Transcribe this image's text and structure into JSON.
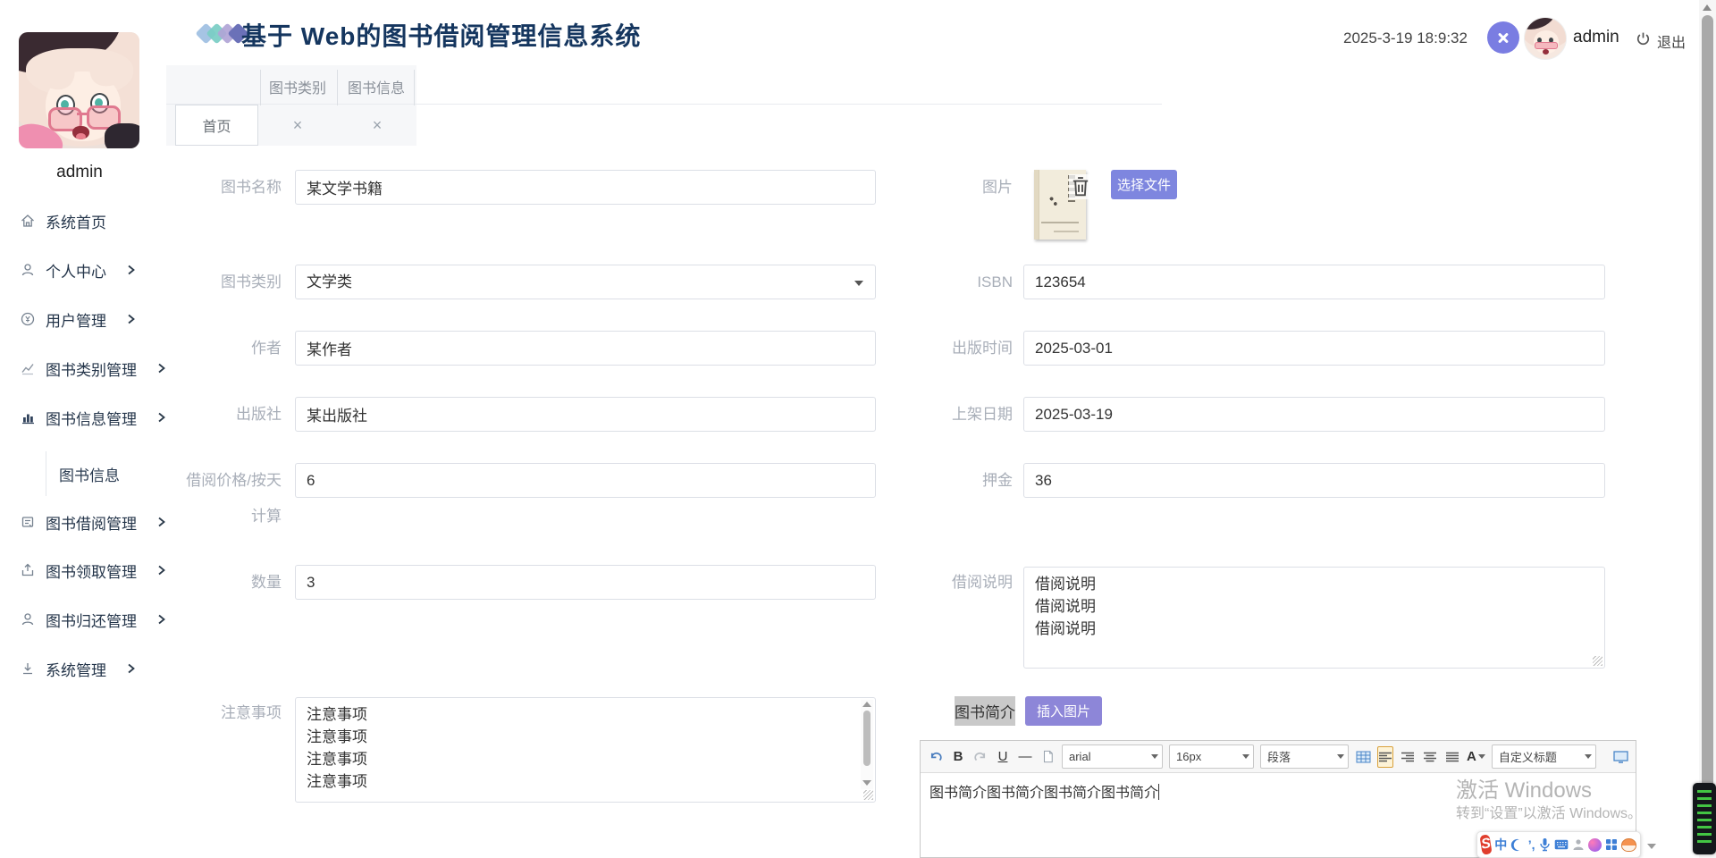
{
  "header": {
    "title": "基于 Web的图书借阅管理信息系统",
    "datetime": "2025-3-19 18:9:32",
    "username": "admin",
    "logout": "退出"
  },
  "sidebar": {
    "username": "admin",
    "items": [
      {
        "label": "系统首页"
      },
      {
        "label": "个人中心"
      },
      {
        "label": "用户管理"
      },
      {
        "label": "图书类别管理"
      },
      {
        "label": "图书信息管理"
      },
      {
        "label": "图书借阅管理"
      },
      {
        "label": "图书领取管理"
      },
      {
        "label": "图书归还管理"
      },
      {
        "label": "系统管理"
      }
    ],
    "submenu": {
      "label": "图书信息"
    }
  },
  "tabs": {
    "home": "首页",
    "category": "图书类别",
    "book_info": "图书信息",
    "close_glyph": "×"
  },
  "form_left": {
    "book_name_label": "图书名称",
    "book_name_value": "某文学书籍",
    "category_label": "图书类别",
    "category_value": "文学类",
    "author_label": "作者",
    "author_value": "某作者",
    "publisher_label": "出版社",
    "publisher_value": "某出版社",
    "price_label_line1": "借阅价格/按天",
    "price_label_line2": "计算",
    "price_value": "6",
    "quantity_label": "数量",
    "quantity_value": "3",
    "notes_label": "注意事项",
    "notes_value": "注意事项\n注意事项\n注意事项\n注意事项"
  },
  "form_right": {
    "image_label": "图片",
    "choose_file_button": "选择文件",
    "isbn_label": "ISBN",
    "isbn_value": "123654",
    "publish_date_label": "出版时间",
    "publish_date_value": "2025-03-01",
    "shelf_date_label": "上架日期",
    "shelf_date_value": "2025-03-19",
    "deposit_label": "押金",
    "deposit_value": "36",
    "borrow_note_label": "借阅说明",
    "borrow_note_value": "借阅说明\n借阅说明\n借阅说明",
    "intro_label": "图书简介",
    "insert_image_button": "插入图片"
  },
  "editor": {
    "bold": "B",
    "underline": "U",
    "hr": "—",
    "color_label": "A",
    "font_family": "arial",
    "font_size": "16px",
    "paragraph": "段落",
    "custom_style": "自定义标题",
    "content": "图书简介图书简介图书简介图书简介"
  },
  "watermark": {
    "line1": "激活 Windows",
    "line2": "转到“设置”以激活 Windows。"
  },
  "ime": {
    "lang": "中",
    "punct": "’,"
  }
}
